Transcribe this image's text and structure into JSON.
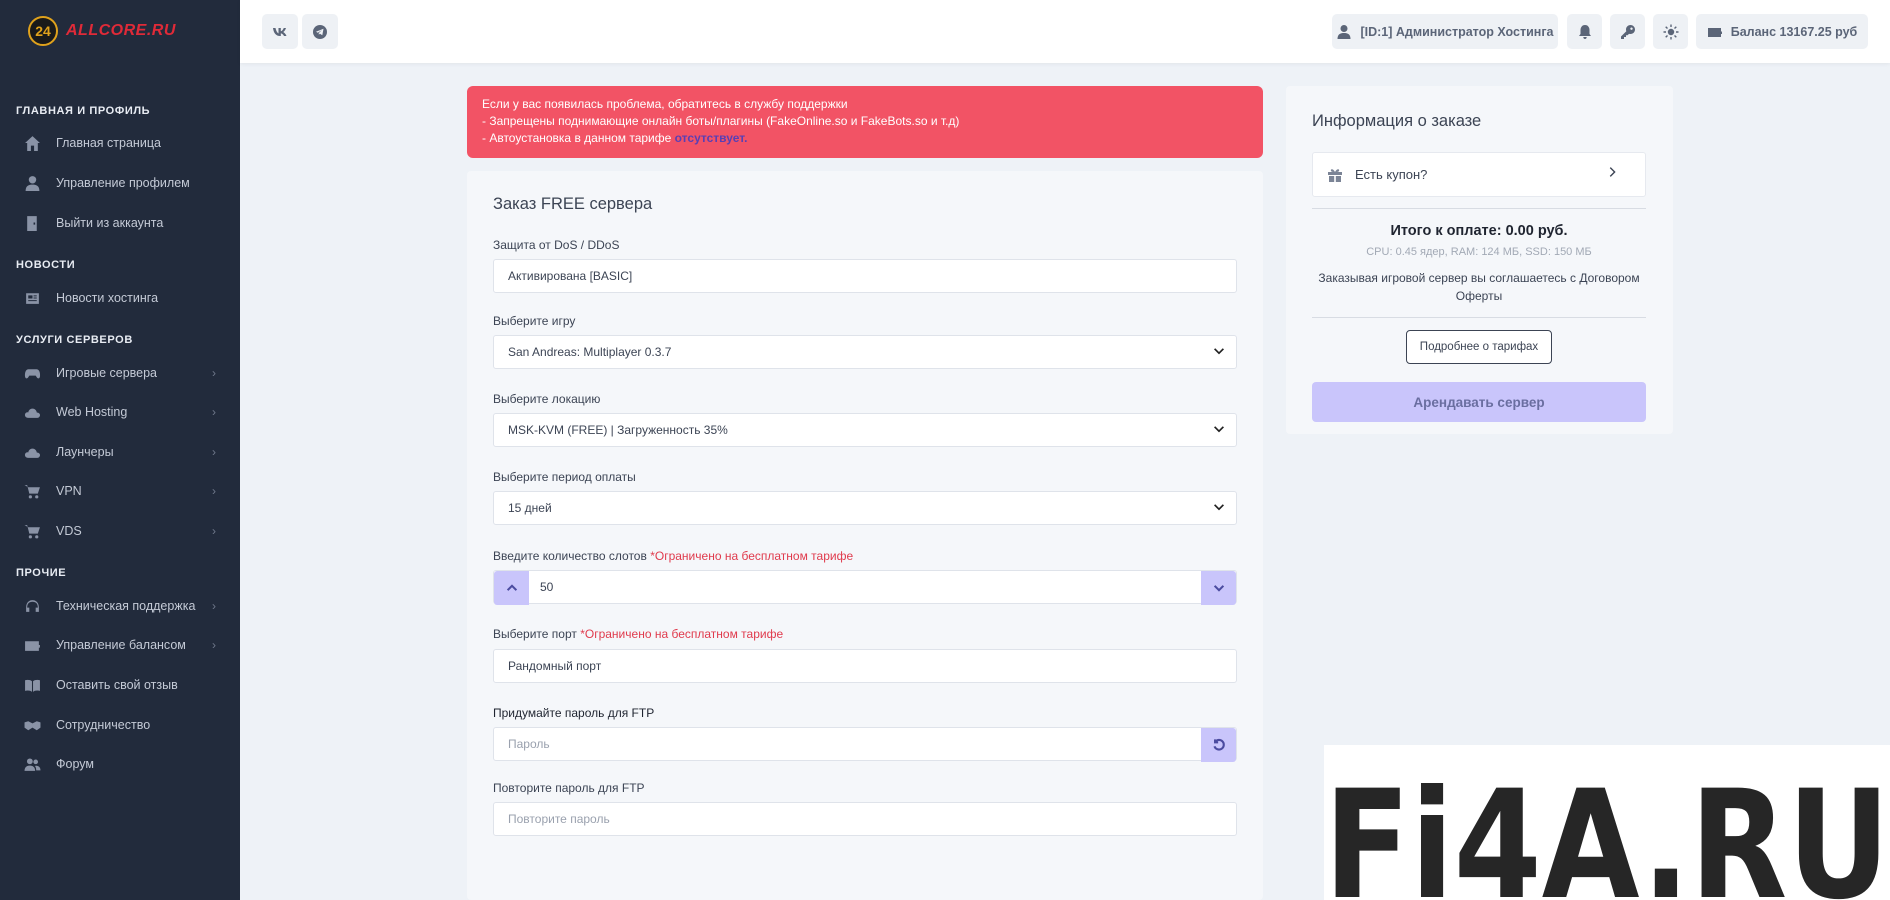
{
  "brand": {
    "logo_number": "24",
    "logo_text": "ALLCORE.RU"
  },
  "sidebar": {
    "sections": [
      {
        "label": "ГЛАВНАЯ И ПРОФИЛЬ"
      },
      {
        "label": "НОВОСТИ"
      },
      {
        "label": "УСЛУГИ СЕРВЕРОВ"
      },
      {
        "label": "ПРОЧИЕ"
      }
    ],
    "items": [
      {
        "label": "Главная страница",
        "icon": "home-icon"
      },
      {
        "label": "Управление профилем",
        "icon": "user-icon"
      },
      {
        "label": "Выйти из аккаунта",
        "icon": "door-icon"
      },
      {
        "label": "Новости хостинга",
        "icon": "newspaper-icon"
      },
      {
        "label": "Игровые сервера",
        "icon": "gamepad-icon"
      },
      {
        "label": "Web Hosting",
        "icon": "cloud-icon"
      },
      {
        "label": "Лаунчеры",
        "icon": "cloud-icon"
      },
      {
        "label": "VPN",
        "icon": "cart-icon"
      },
      {
        "label": "VDS",
        "icon": "cart-icon"
      },
      {
        "label": "Техническая поддержка",
        "icon": "headset-icon"
      },
      {
        "label": "Управление балансом",
        "icon": "wallet-icon"
      },
      {
        "label": "Оставить свой отзыв",
        "icon": "book-icon"
      },
      {
        "label": "Сотрудничество",
        "icon": "handshake-icon"
      },
      {
        "label": "Форум",
        "icon": "users-icon"
      }
    ]
  },
  "header": {
    "user_label": "[ID:1] Администратор Хостинга",
    "balance_label": "Баланс 13167.25 руб"
  },
  "alert": {
    "line1": "Если у вас появилась проблема, обратитесь в службу поддержки",
    "line2": "- Запрещены поднимающие онлайн боты/плагины (FakeOnline.so и FakeBots.so и т.д)",
    "line3_prefix": "- Автоустановка в данном тарифе ",
    "line3_highlight": "отсутствует.",
    "bg_color": "#f25365"
  },
  "order_form": {
    "title": "Заказ FREE сервера",
    "ddos": {
      "label": "Защита от DoS / DDoS",
      "value": "Активирована [BASIC]"
    },
    "game": {
      "label": "Выберите игру",
      "value": "San Andreas: Multiplayer 0.3.7"
    },
    "location": {
      "label": "Выберите локацию",
      "value": "MSK-KVM (FREE) | Загруженность 35%"
    },
    "period": {
      "label": "Выберите период оплаты",
      "value": "15 дней"
    },
    "slots": {
      "label": "Введите количество слотов ",
      "required_note": "*Ограничено на бесплатном тарифе",
      "value": "50"
    },
    "port": {
      "label": "Выберите порт ",
      "required_note": "*Ограничено на бесплатном тарифе",
      "value": "Рандомный порт"
    },
    "ftp_password": {
      "label": "Придумайте пароль для FTP",
      "placeholder": "Пароль"
    },
    "ftp_password_repeat": {
      "label": "Повторите пароль для FTP",
      "placeholder": "Повторите пароль"
    }
  },
  "order_info": {
    "title": "Информация о заказе",
    "coupon_label": "Есть купон?",
    "total": "Итого к оплате: 0.00 руб.",
    "specs": "CPU: 0.45 ядер, RAM: 124 МБ, SSD: 150 МБ",
    "agree_line1": "Заказывая игровой сервер вы соглашаетесь с Договором",
    "agree_line2": "Оферты",
    "more_button": "Подробнее о тарифах",
    "rent_button": "Арендавать сервер"
  },
  "watermark": {
    "text": "Fi4A.RU"
  },
  "colors": {
    "sidebar": "#222b3c",
    "accent_soft": "#c9c5fb",
    "alert": "#f25365"
  }
}
